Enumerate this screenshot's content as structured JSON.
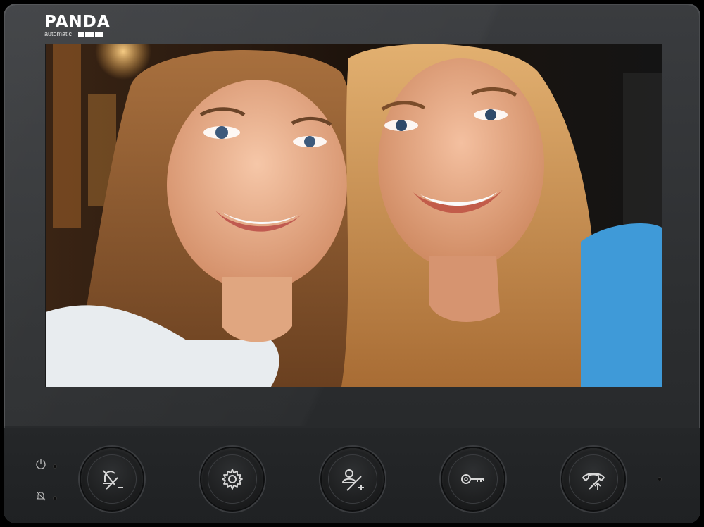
{
  "brand": {
    "name": "PANDA",
    "subtitle": "automatic"
  },
  "screen": {
    "content": "video-feed-two-smiling-girls"
  },
  "status_indicators": [
    {
      "icon": "power-icon"
    },
    {
      "icon": "mute-bell-icon"
    }
  ],
  "buttons": [
    {
      "name": "mute-volume-down-button",
      "icon": "bell-off-minus-icon"
    },
    {
      "name": "settings-button",
      "icon": "gear-icon"
    },
    {
      "name": "contacts-volume-up-button",
      "icon": "user-plus-icon"
    },
    {
      "name": "unlock-button",
      "icon": "key-icon"
    },
    {
      "name": "call-button",
      "icon": "handset-icon"
    }
  ],
  "colors": {
    "bezel": "#2c2e30",
    "panel": "#1f2123",
    "icon": "#d8d8d8"
  }
}
